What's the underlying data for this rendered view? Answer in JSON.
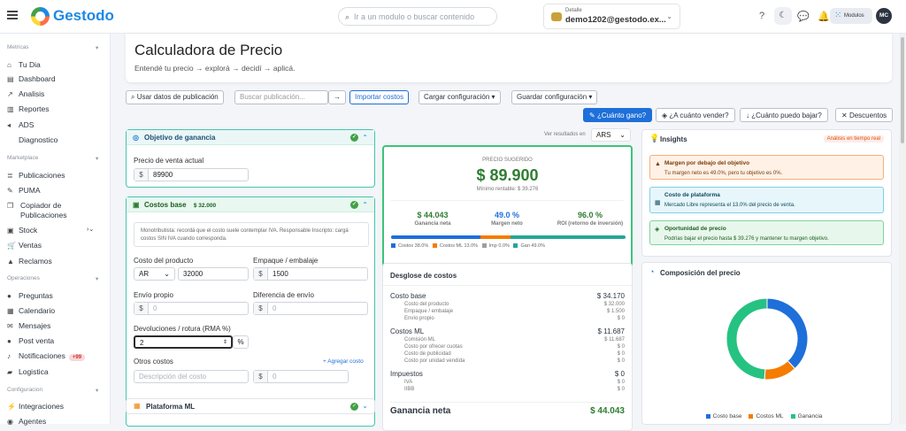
{
  "app": {
    "name": "Gestodo"
  },
  "topbar": {
    "search_placeholder": "Ir a un modulo o buscar contenido",
    "account_label": "Detalle",
    "account_email": "demo1202@gestodo.ex...",
    "modulos_label": "Modulos",
    "avatar_initials": "MC"
  },
  "sidebar": {
    "sections": [
      {
        "title": "Metricas",
        "items": [
          "Tu Dia",
          "Dashboard",
          "Analisis",
          "Reportes",
          "ADS",
          "Diagnostico"
        ]
      },
      {
        "title": "Marketplace",
        "items": [
          "Publicaciones",
          "PUMA",
          "Copiador de Publicaciones",
          "Stock",
          "Ventas",
          "Reclamos"
        ]
      },
      {
        "title": "Operaciones",
        "items": [
          "Preguntas",
          "Calendario",
          "Mensajes",
          "Post venta",
          "Notificaciones",
          "Logistica"
        ]
      },
      {
        "title": "Configuracion",
        "items": [
          "Integraciones",
          "Agentes"
        ]
      }
    ],
    "notif_badge": "+99"
  },
  "header": {
    "title": "Calculadora de Precio",
    "subtitle": "Entendé tu precio → explorá → decidí → aplicá."
  },
  "toolbar": {
    "use_pub": "Usar datos de publicación",
    "search_pub_placeholder": "Buscar publicación...",
    "import_costs": "Importar costos",
    "load_config": "Cargar configuración",
    "save_config": "Guardar configuración"
  },
  "modes": [
    "¿Cuánto gano?",
    "¿A cuánto vender?",
    "¿Cuánto puedo bajar?",
    "Descuentos"
  ],
  "goal_card": {
    "title": "Objetivo de ganancia",
    "price_label": "Precio de venta actual",
    "currency": "$",
    "price_value": "89900"
  },
  "costs_card": {
    "title": "Costos base",
    "total": "$ 32.000",
    "note": "Monotributista: recordá que el costo suele contemplar IVA. Responsable Inscripto: cargá costos SIN IVA cuando corresponda.",
    "product_cost_label": "Costo del producto",
    "product_currency": "AR",
    "product_cost_value": "32000",
    "packaging_label": "Empaque / embalaje",
    "packaging_value": "1500",
    "own_shipping_label": "Envío propio",
    "own_shipping_value": "0",
    "shipping_diff_label": "Diferencia de envío",
    "shipping_diff_value": "0",
    "returns_label": "Devoluciones / rotura (RMA %)",
    "returns_value": "2",
    "returns_unit": "%",
    "other_costs_label": "Otros costos",
    "add_cost": "+ Agregar costo",
    "other_desc_placeholder": "Descripción del costo",
    "other_value": "0"
  },
  "platform_card": {
    "title": "Plataforma ML"
  },
  "results": {
    "view_in_label": "Ver resultados en",
    "currency": "ARS",
    "suggested_label": "PRECIO SUGERIDO",
    "suggested_price": "$ 89.900",
    "min_profitable": "Mínimo rentable: $ 39.276",
    "kpis": [
      {
        "value": "$ 44.043",
        "label": "Ganancia neta",
        "color": "#2e7d32"
      },
      {
        "value": "49.0 %",
        "label": "Margen neto",
        "color": "#1e6fd9"
      },
      {
        "value": "96.0 %",
        "label": "ROI (retorno de inversión)",
        "color": "#2e7d32"
      }
    ],
    "bar_legend": [
      {
        "label": "Costos 38.0%",
        "color": "#1e6fd9",
        "pct": 38.0
      },
      {
        "label": "Costos ML 13.0%",
        "color": "#f57c00",
        "pct": 13.0
      },
      {
        "label": "Imp 0.0%",
        "color": "#9e9e9e",
        "pct": 0.0
      },
      {
        "label": "Gan 49.0%",
        "color": "#26a69a",
        "pct": 49.0
      }
    ]
  },
  "breakdown": {
    "title": "Desglose de costos",
    "groups": [
      {
        "name": "Costo base",
        "total": "$ 34.170",
        "rows": [
          [
            "Costo del producto",
            "$ 32.000"
          ],
          [
            "Empaque / embalaje",
            "$ 1.500"
          ],
          [
            "Envío propio",
            "$ 0"
          ]
        ]
      },
      {
        "name": "Costos ML",
        "total": "$ 11.687",
        "rows": [
          [
            "Comisión ML",
            "$ 11.687"
          ],
          [
            "Costo por ofrecer cuotas",
            "$ 0"
          ],
          [
            "Costo de publicidad",
            "$ 0"
          ],
          [
            "Costo por unidad vendida",
            "$ 0"
          ]
        ]
      },
      {
        "name": "Impuestos",
        "total": "$ 0",
        "rows": [
          [
            "IVA",
            "$ 0"
          ],
          [
            "IIBB",
            "$ 0"
          ]
        ]
      }
    ],
    "net_label": "Ganancia neta",
    "net_value": "$ 44.043"
  },
  "insights": {
    "title": "Insights",
    "badge": "Análisis en tiempo real",
    "alerts": [
      {
        "title": "Margen por debajo del objetivo",
        "text": "Tu margen neto es 49.0%, pero tu objetivo es 0%."
      },
      {
        "title": "Costo de plataforma",
        "text": "Mercado Libre representa el 13.0% del precio de venta."
      },
      {
        "title": "Oportunidad de precio",
        "text": "Podrías bajar el precio hasta $ 39.276 y mantener tu margen objetivo."
      }
    ]
  },
  "composition": {
    "title": "Composición del precio",
    "chart_data": {
      "type": "pie",
      "categories": [
        "Costo base",
        "Costos ML",
        "Ganancia"
      ],
      "values": [
        38.0,
        13.0,
        49.0
      ],
      "colors": [
        "#1e6fd9",
        "#f57c00",
        "#26c281"
      ]
    }
  }
}
